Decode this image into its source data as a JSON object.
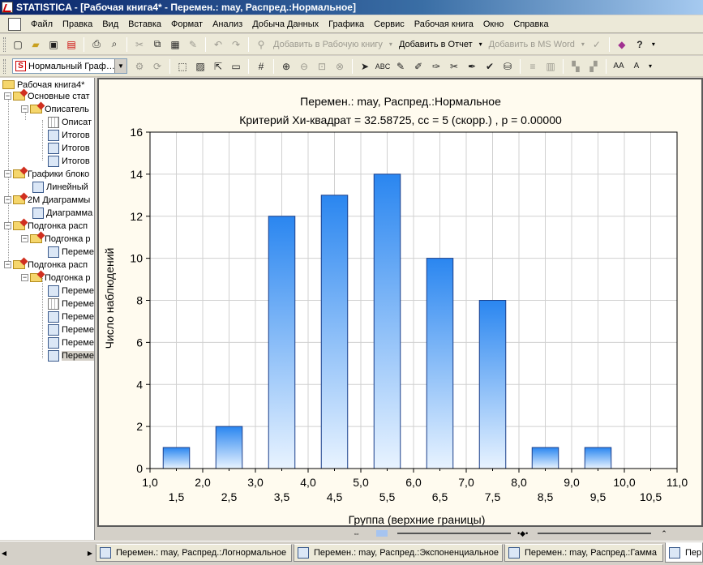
{
  "window": {
    "title": "STATISTICA - [Рабочая книга4* - Перемен.: may, Распред.:Нормальное]"
  },
  "menu": [
    "Файл",
    "Правка",
    "Вид",
    "Вставка",
    "Формат",
    "Анализ",
    "Добыча Данных",
    "Графика",
    "Сервис",
    "Рабочая книга",
    "Окно",
    "Справка"
  ],
  "toolbar1": {
    "add_workbook": "Добавить в Рабочую книгу",
    "add_report": "Добавить в Отчет",
    "add_word": "Добавить в MS Word"
  },
  "toolbar2": {
    "graph_combo_value": "Нормальный Граф…"
  },
  "tree": {
    "workbook": "Рабочая книга4*",
    "nodes": [
      "Основные стат",
      "Описатель",
      "Описат",
      "Итогов",
      "Итогов",
      "Итогов",
      "Графики блоко",
      "Линейный",
      "2М Диаграммы",
      "Диаграмма",
      "Подгонка расп",
      "Подгонка р",
      "Перемен",
      "Подгонка расп",
      "Подгонка р",
      "Перемен",
      "Перемен",
      "Перемен",
      "Перемен",
      "Перемен",
      "Перемен"
    ]
  },
  "chart_data": {
    "type": "bar",
    "title": "Перемен.: may, Распред.:Нормальное",
    "subtitle": "Критерий Хи-квадрат = 32.58725, сс = 5 (скорр.) , p = 0.00000",
    "xlabel": "Группа (верхние границы)",
    "ylabel": "Число наблюдений",
    "ylim": [
      0,
      16
    ],
    "yticks": [
      0,
      2,
      4,
      6,
      8,
      10,
      12,
      14,
      16
    ],
    "xlim": [
      1.0,
      11.0
    ],
    "x_ticks_major": [
      "1,0",
      "2,0",
      "3,0",
      "4,0",
      "5,0",
      "6,0",
      "7,0",
      "8,0",
      "9,0",
      "10,0",
      "11,0"
    ],
    "x_ticks_minor": [
      "1,5",
      "2,5",
      "3,5",
      "4,5",
      "5,5",
      "6,5",
      "7,5",
      "8,5",
      "9,5",
      "10,5"
    ],
    "categories": [
      "2,0",
      "3,0",
      "4,0",
      "5,0",
      "6,0",
      "7,0",
      "8,0",
      "9,0",
      "10,0"
    ],
    "values": [
      1,
      2,
      12,
      13,
      14,
      10,
      8,
      1,
      1
    ],
    "grid": true,
    "colors": {
      "bar_top": "#2a86f0",
      "bar_bottom": "#e8f3ff",
      "bar_stroke": "#1a3f8a",
      "background": "#fffbef",
      "plot_bg": "#ffffff"
    }
  },
  "tabs": [
    "Перемен.: may, Распред.:Логнормальное",
    "Перемен.: may, Распред.:Экспоненциальное",
    "Перемен.: may, Распред.:Гамма",
    "Пер"
  ]
}
